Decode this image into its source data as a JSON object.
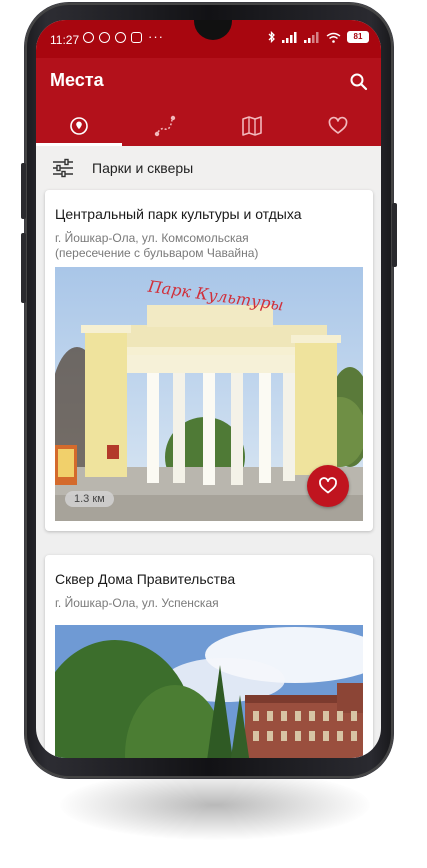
{
  "status_bar": {
    "time": "11:27",
    "dots": "···",
    "battery": "81"
  },
  "app_bar": {
    "title": "Места",
    "search_icon": "search-icon"
  },
  "tabs": [
    {
      "icon": "place-pin-icon",
      "active": true
    },
    {
      "icon": "route-icon",
      "active": false
    },
    {
      "icon": "map-icon",
      "active": false
    },
    {
      "icon": "heart-icon",
      "active": false
    }
  ],
  "filter": {
    "icon": "sliders-icon",
    "label": "Парки и скверы"
  },
  "cards": [
    {
      "title": "Центральный парк культуры и отдыха",
      "address_line1": "г. Йошкар-Ола, ул. Комсомольская",
      "address_line2": "(пересечение с бульваром Чавайна)",
      "photo_sign": "Парк Культуры",
      "distance": "1.3 км",
      "favorite_icon": "heart-outline-icon"
    },
    {
      "title": "Сквер Дома Правительства",
      "address_line1": "г. Йошкар-Ола, ул. Успенская"
    }
  ],
  "colors": {
    "primary": "#b3111b",
    "status": "#a8060f",
    "accent": "#c0141f"
  }
}
